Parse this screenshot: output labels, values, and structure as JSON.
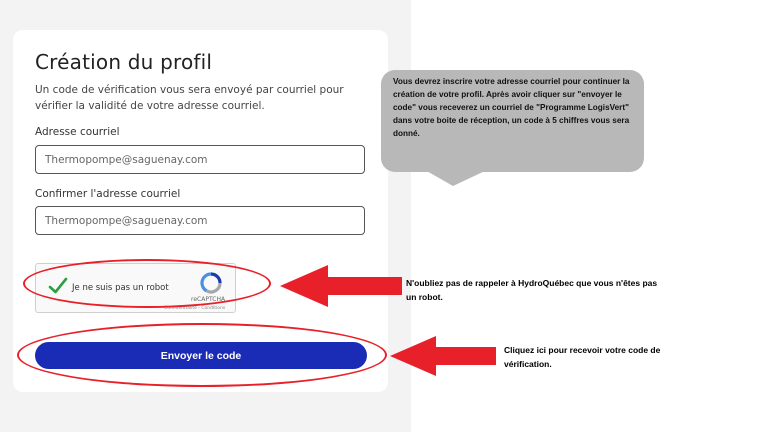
{
  "form": {
    "title": "Création du profil",
    "description": "Un code de vérification vous sera envoyé par courriel pour vérifier la validité de votre adresse courriel.",
    "email_label": "Adresse courriel",
    "email_value": "Thermopompe@saguenay.com",
    "confirm_label": "Confirmer l'adresse courriel",
    "confirm_value": "Thermopompe@saguenay.com",
    "submit_label": "Envoyer le code"
  },
  "captcha": {
    "label": "Je ne suis pas un robot",
    "brand": "reCAPTCHA",
    "terms": "Confidentialité - Conditions",
    "checked": true
  },
  "annotations": {
    "bubble_text": "Vous devrez inscrire votre adresse courriel pour continuer la création de votre profil. Après avoir cliquer sur \"envoyer le code\" vous receverez un courriel de \"Programme LogisVert\" dans votre boite de réception, un code à 5 chiffres vous sera donné.",
    "captcha_note": "N'oubliez pas de rappeler à HydroQuébec que vous n'êtes pas un robot.",
    "submit_note": "Cliquez ici pour recevoir votre code de vérification."
  },
  "colors": {
    "primary_button": "#1a2bb5",
    "annotation_red": "#e8202a",
    "bubble_gray": "#b8b8b8",
    "check_green": "#2e9e44"
  },
  "icons": {
    "captcha_check": "check-icon",
    "captcha_logo": "recaptcha-logo-icon"
  }
}
